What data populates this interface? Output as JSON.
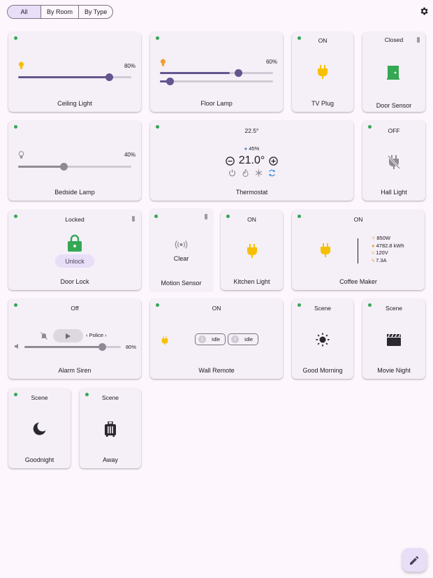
{
  "filters": [
    "All",
    "By Room",
    "By Type"
  ],
  "cards": {
    "ceiling_light": {
      "label": "Ceiling Light",
      "percent": "80%",
      "level": 0.8
    },
    "floor_lamp": {
      "label": "Floor Lamp",
      "percent": "60%",
      "level": 0.6
    },
    "tv_plug": {
      "label": "TV Plug",
      "state": "ON"
    },
    "door_sensor": {
      "label": "Door Sensor",
      "state": "Closed"
    },
    "bedside_lamp": {
      "label": "Bedside Lamp",
      "percent": "40%",
      "level": 0.4
    },
    "thermostat": {
      "label": "Thermostat",
      "current": "22.5°",
      "humidity": "45%",
      "setpoint": "21.0°"
    },
    "hall_light": {
      "label": "Hall Light",
      "state": "OFF"
    },
    "door_lock": {
      "label": "Door Lock",
      "state": "Locked",
      "action": "Unlock"
    },
    "motion_sensor": {
      "label": "Motion Sensor",
      "state": "Clear"
    },
    "kitchen_light": {
      "label": "Kitchen Light",
      "state": "ON"
    },
    "coffee_maker": {
      "label": "Coffee Maker",
      "state": "ON",
      "power": "850W",
      "energy": "4782.8 kWh",
      "voltage": "120V",
      "current": "7.3A"
    },
    "alarm_siren": {
      "label": "Alarm Siren",
      "state": "Off",
      "tone": "Police",
      "volume": "80%",
      "level": 0.8
    },
    "wall_remote": {
      "label": "Wall Remote",
      "state": "ON",
      "btn1_num": "1",
      "btn1": "Idle",
      "btn2_num": "2",
      "btn2": "Idle"
    },
    "good_morning": {
      "label": "Good Morning",
      "state": "Scene"
    },
    "movie_night": {
      "label": "Movie Night",
      "state": "Scene"
    },
    "goodnight": {
      "label": "Goodnight",
      "state": "Scene"
    },
    "away": {
      "label": "Away",
      "state": "Scene"
    }
  },
  "colors": {
    "accent": "#65558f",
    "online": "#34a853",
    "plug": "#f6c000",
    "lock": "#34a853"
  }
}
